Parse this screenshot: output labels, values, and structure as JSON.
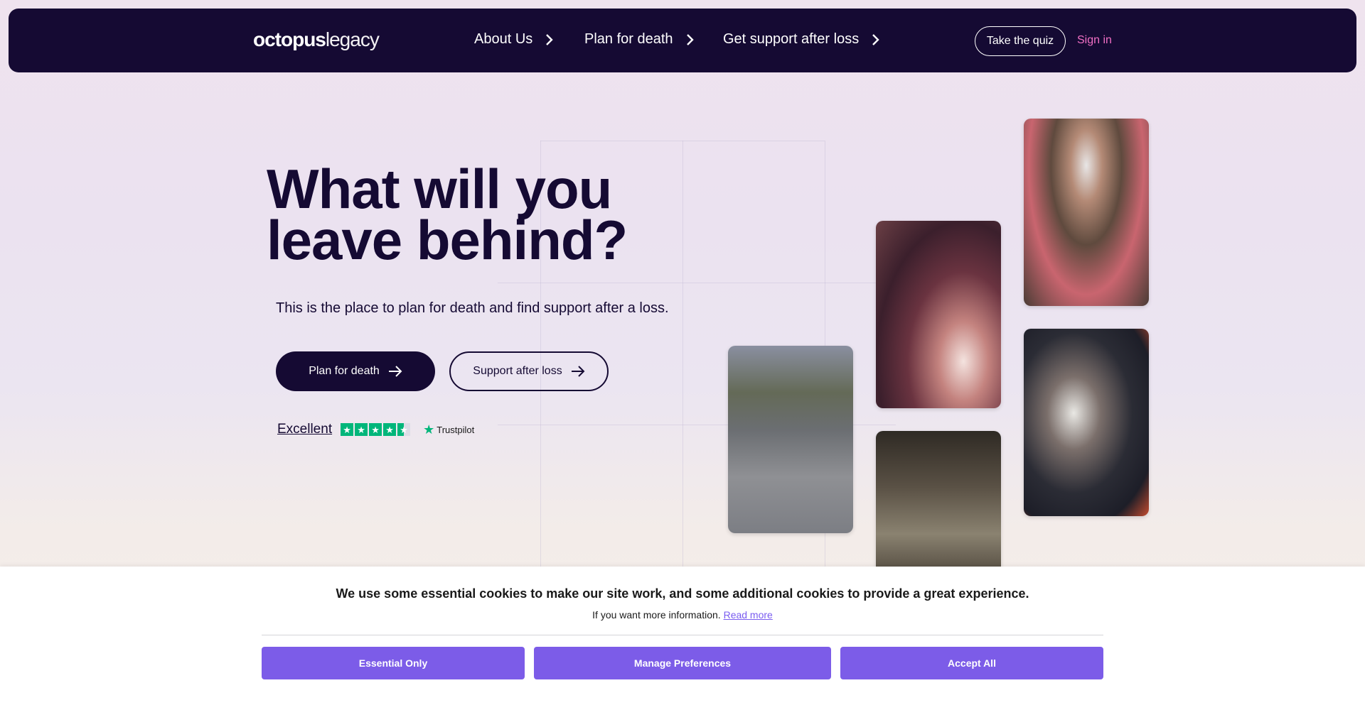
{
  "nav": {
    "logo_bold": "octopus",
    "logo_light": "legacy",
    "links": [
      {
        "label": "About Us"
      },
      {
        "label": "Plan for death"
      },
      {
        "label": "Get support after loss"
      }
    ],
    "quiz_button": "Take the quiz",
    "sign_in": "Sign in"
  },
  "hero": {
    "title_line1": "What will you",
    "title_line2": "leave behind?",
    "subtitle": "This is the place to plan for death and find support after a loss.",
    "primary_button": "Plan for death",
    "secondary_button": "Support after loss",
    "rating_word": "Excellent",
    "rating_stars": 4.5,
    "trustpilot": "Trustpilot"
  },
  "photos": [
    {
      "name": "child-bicycle-photo"
    },
    {
      "name": "birthday-cake-photo"
    },
    {
      "name": "doghouse-photo"
    },
    {
      "name": "child-helmet-photo"
    },
    {
      "name": "firefighter-child-photo"
    }
  ],
  "cookie": {
    "title": "We use some essential cookies to make our site work, and some additional cookies to provide a great experience.",
    "info_text": "If you want more information.",
    "read_more": "Read more",
    "buttons": {
      "essential": "Essential Only",
      "manage": "Manage Preferences",
      "accept": "Accept All"
    }
  },
  "colors": {
    "nav_bg": "#150a33",
    "sign_in": "#f06fc4",
    "cookie_button": "#7c5ce8",
    "trustpilot_green": "#00b67a"
  }
}
